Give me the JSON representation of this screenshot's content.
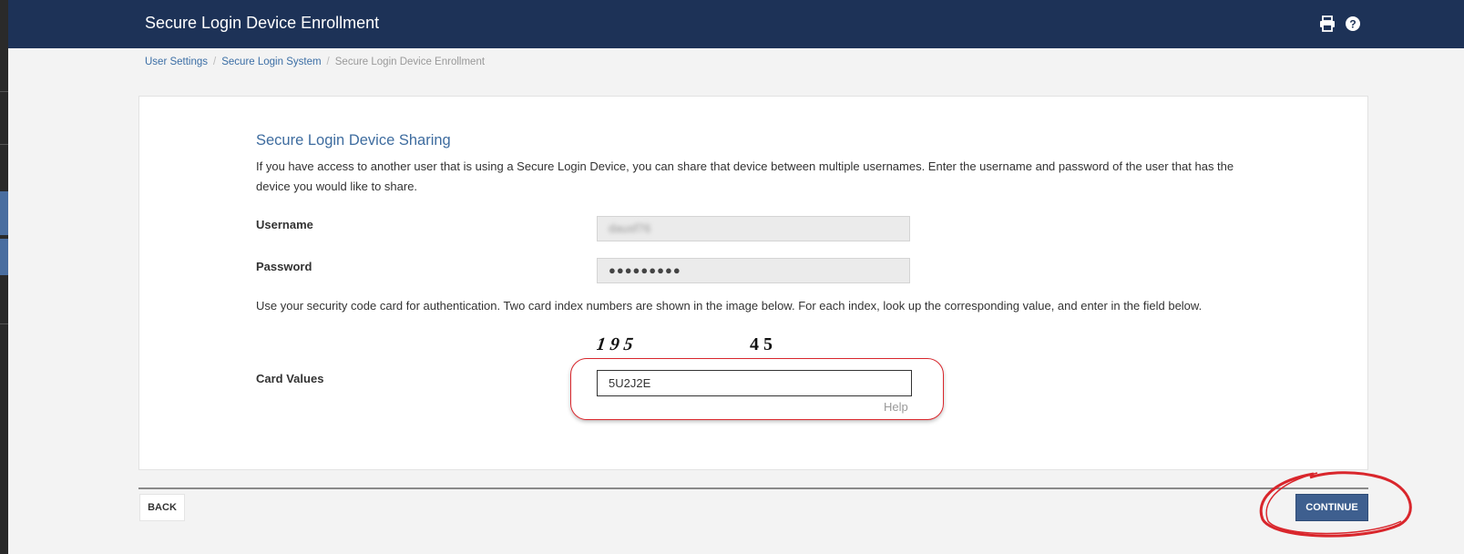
{
  "header": {
    "title": "Secure Login Device Enrollment",
    "icons": [
      "print-icon",
      "help-icon"
    ]
  },
  "breadcrumb": {
    "items": [
      "User Settings",
      "Secure Login System"
    ],
    "current": "Secure Login Device Enrollment"
  },
  "section": {
    "title": "Secure Login Device Sharing",
    "intro": "If you have access to another user that is using a Secure Login Device, you can share that device between multiple usernames. Enter the username and password of the user that has the device you would like to share."
  },
  "form": {
    "username_label": "Username",
    "username_value": "dausf76",
    "password_label": "Password",
    "password_value": "●●●●●●●●●",
    "instruction": "Use your security code card for authentication. Two card index numbers are shown in the image below. For each index, look up the corresponding value, and enter in the field below.",
    "card_index_1": "1 9 5",
    "card_index_2": "4 5",
    "card_values_label": "Card Values",
    "card_values_value": "5U2J2E",
    "help_label": "Help"
  },
  "footer": {
    "back_label": "BACK",
    "continue_label": "CONTINUE"
  },
  "colors": {
    "header_bg": "#1d3257",
    "accent": "#3e6c9f",
    "continue_button": "#3e5f8f",
    "annotation_red": "#d9262c"
  }
}
